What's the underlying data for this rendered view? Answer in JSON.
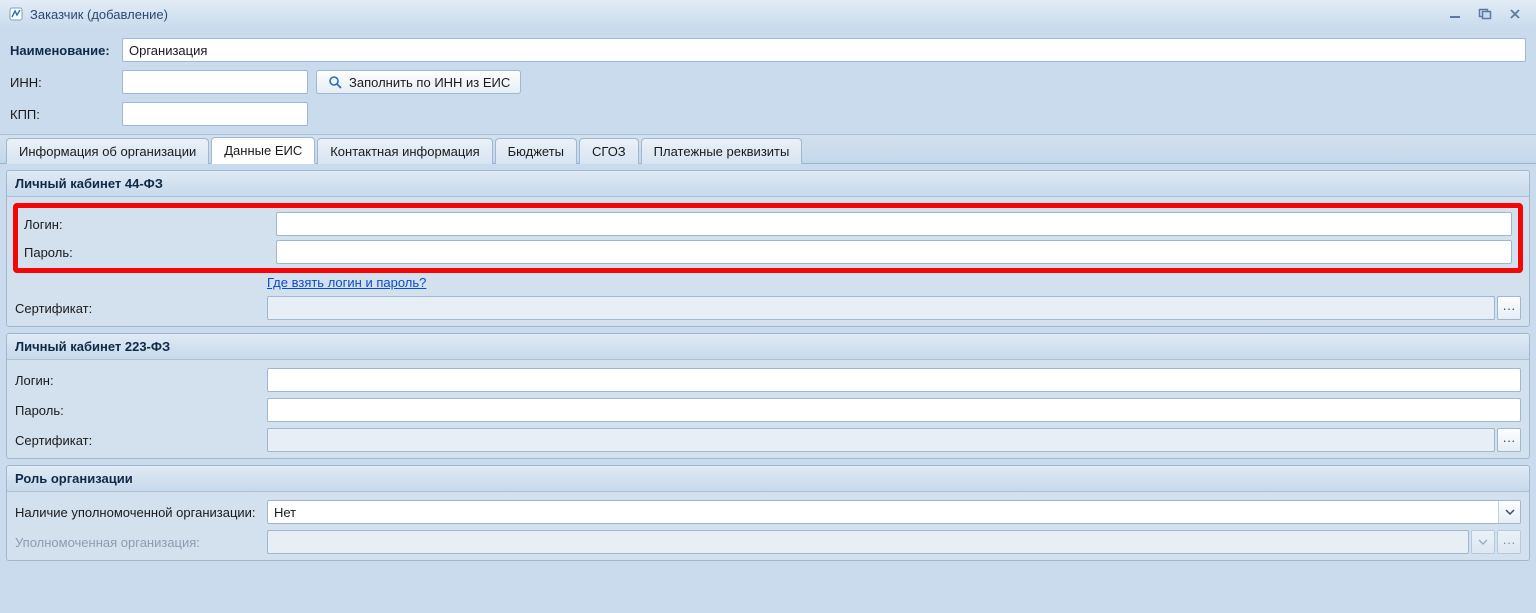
{
  "window": {
    "title": "Заказчик (добавление)"
  },
  "top": {
    "name_label": "Наименование:",
    "name_value": "Организация",
    "inn_label": "ИНН:",
    "inn_value": "",
    "kpp_label": "КПП:",
    "kpp_value": "",
    "fill_button": "Заполнить по ИНН из ЕИС"
  },
  "tabs": {
    "t0": "Информация об организации",
    "t1": "Данные ЕИС",
    "t2": "Контактная информация",
    "t3": "Бюджеты",
    "t4": "СГОЗ",
    "t5": "Платежные реквизиты"
  },
  "group44": {
    "title": "Личный кабинет 44-ФЗ",
    "login_label": "Логин:",
    "login_value": "",
    "password_label": "Пароль:",
    "password_value": "",
    "help_link": "Где взять логин и пароль?",
    "cert_label": "Сертификат:",
    "cert_value": ""
  },
  "group223": {
    "title": "Личный кабинет 223-ФЗ",
    "login_label": "Логин:",
    "login_value": "",
    "password_label": "Пароль:",
    "password_value": "",
    "cert_label": "Сертификат:",
    "cert_value": ""
  },
  "role": {
    "title": "Роль организации",
    "hasauth_label": "Наличие уполномоченной организации:",
    "hasauth_value": "Нет",
    "authorg_label": "Уполномоченная организация:",
    "authorg_value": ""
  }
}
